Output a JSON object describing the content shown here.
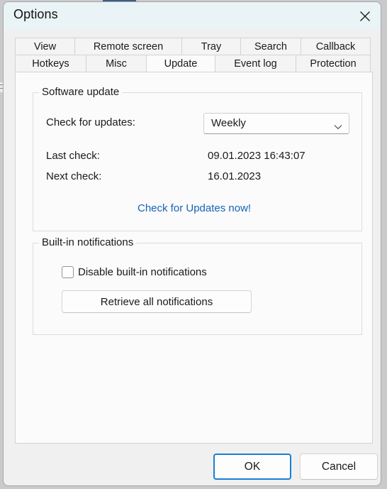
{
  "window": {
    "title": "Options",
    "close_icon": "close-icon"
  },
  "tabs": {
    "row1": [
      {
        "label": "View",
        "key": "view",
        "selected": false
      },
      {
        "label": "Remote screen",
        "key": "remote-screen",
        "selected": false
      },
      {
        "label": "Tray",
        "key": "tray",
        "selected": false
      },
      {
        "label": "Search",
        "key": "search",
        "selected": false
      },
      {
        "label": "Callback",
        "key": "callback",
        "selected": false
      }
    ],
    "row2": [
      {
        "label": "Hotkeys",
        "key": "hotkeys",
        "selected": false
      },
      {
        "label": "Misc",
        "key": "misc",
        "selected": false
      },
      {
        "label": "Update",
        "key": "update",
        "selected": true
      },
      {
        "label": "Event log",
        "key": "event-log",
        "selected": false
      },
      {
        "label": "Protection",
        "key": "protection",
        "selected": false
      }
    ]
  },
  "software_update": {
    "caption": "Software update",
    "check_for_updates_label": "Check for updates:",
    "frequency_value": "Weekly",
    "frequency_options": [
      "Weekly"
    ],
    "chevron_icon": "chevron-down-icon",
    "last_check_label": "Last check:",
    "last_check_value": "09.01.2023 16:43:07",
    "next_check_label": "Next check:",
    "next_check_value": "16.01.2023",
    "check_now_link": "Check for Updates now!"
  },
  "builtin_notifications": {
    "caption": "Built-in notifications",
    "disable_checkbox_label": "Disable built-in notifications",
    "disable_checkbox_checked": false,
    "retrieve_button_label": "Retrieve all notifications"
  },
  "footer": {
    "ok_label": "OK",
    "cancel_label": "Cancel"
  },
  "colors": {
    "accent": "#1a7fd4",
    "link": "#1763b8",
    "titlebar": "#eaf3f5",
    "dialog_bg": "#f0f0f0",
    "page_bg": "#fbfbfb"
  }
}
